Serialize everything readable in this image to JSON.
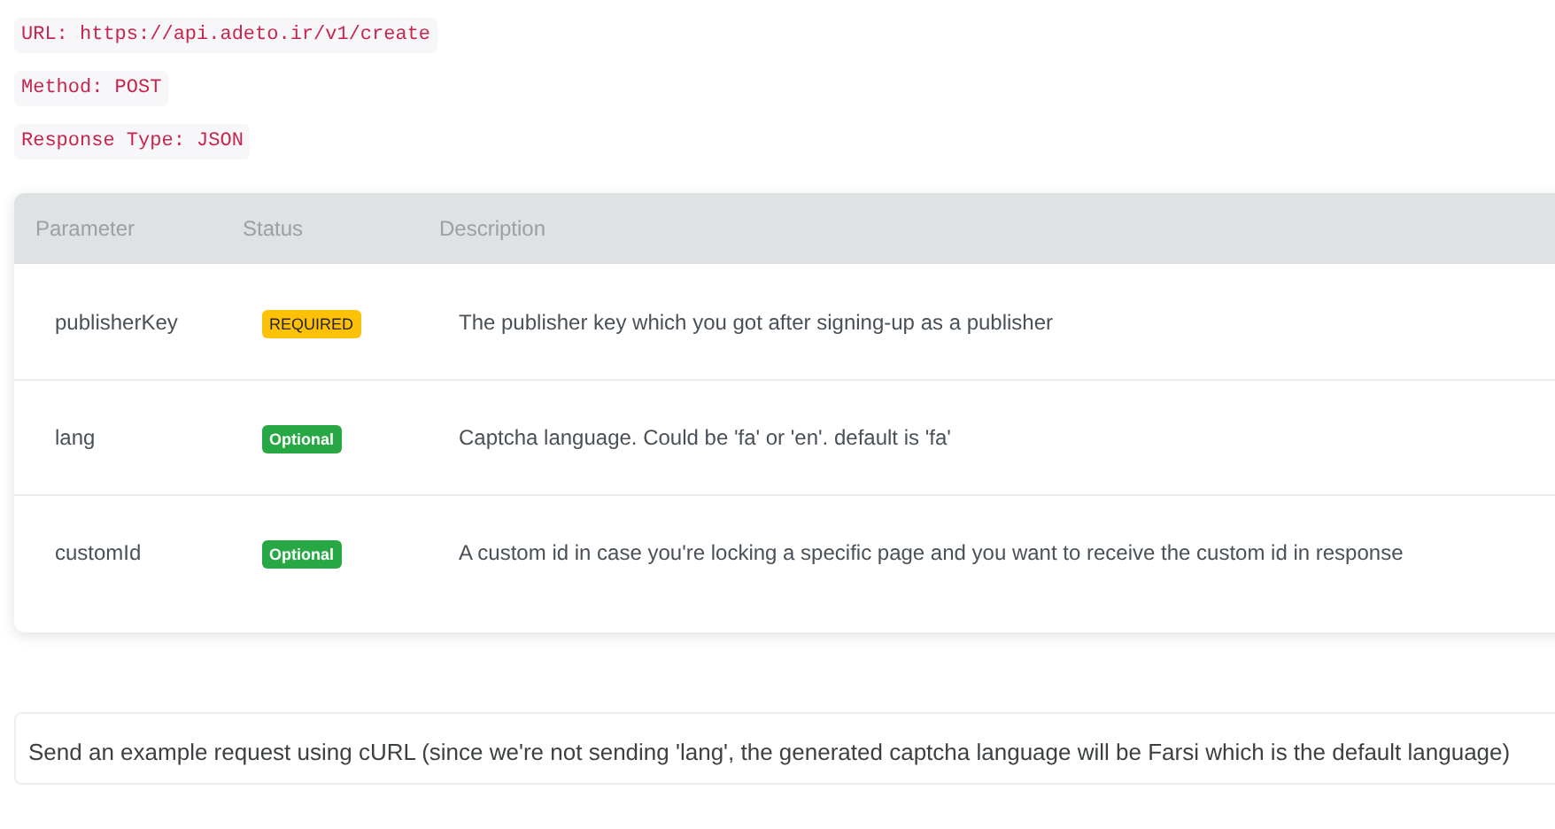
{
  "endpoint_info": [
    {
      "text": "URL: https://api.adeto.ir/v1/create"
    },
    {
      "text": "Method: POST"
    },
    {
      "text": "Response Type: JSON"
    }
  ],
  "table": {
    "columns": [
      "Parameter",
      "Status",
      "Description"
    ],
    "rows": [
      {
        "parameter": "publisherKey",
        "status": {
          "label": "REQUIRED",
          "kind": "required"
        },
        "description": "The publisher key which you got after signing-up as a publisher"
      },
      {
        "parameter": "lang",
        "status": {
          "label": "Optional",
          "kind": "optional"
        },
        "description": "Captcha language. Could be 'fa' or 'en'. default is 'fa'"
      },
      {
        "parameter": "customId",
        "status": {
          "label": "Optional",
          "kind": "optional"
        },
        "description": "A custom id in case you're locking a specific page and you want to receive the custom id in response"
      }
    ]
  },
  "note": "Send an example request using cURL (since we're not sending 'lang', the generated captcha language will be Farsi which is the default language)"
}
